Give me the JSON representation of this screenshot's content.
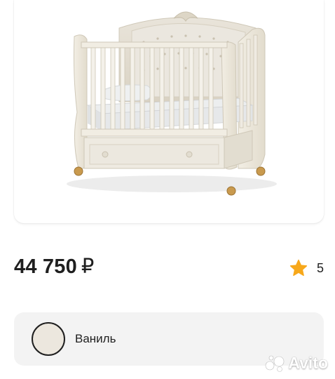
{
  "product": {
    "image_subject": "crib-photo",
    "price_value": "44 750",
    "price_currency": "₽",
    "rating_value": "5"
  },
  "option": {
    "color_name": "Ваниль",
    "swatch_color": "#ece7de"
  },
  "watermark": {
    "text": "Avito",
    "icon": "avito-logo-icon"
  },
  "colors": {
    "star": "#f7a81b",
    "text": "#1f1f1f",
    "panel": "#f3f3f3"
  }
}
